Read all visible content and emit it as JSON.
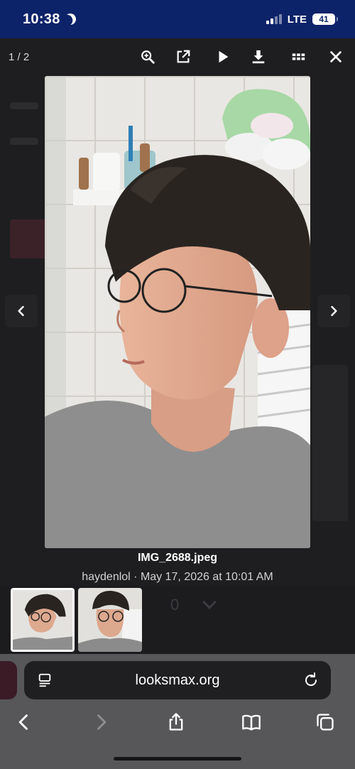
{
  "status": {
    "time": "10:38",
    "network": "LTE",
    "battery": "41"
  },
  "lightbox": {
    "counter": "1 / 2",
    "toolbar_icons": [
      "zoom-in-icon",
      "open-external-icon",
      "play-icon",
      "download-icon",
      "grid-icon",
      "close-icon"
    ],
    "caption": {
      "filename": "IMG_2688.jpeg",
      "meta": "haydenlol · May 17, 2026 at 10:01 AM"
    },
    "thumbnails": [
      {
        "label": "thumbnail-1",
        "selected": true
      },
      {
        "label": "thumbnail-2",
        "selected": false
      }
    ],
    "behind_text": "0"
  },
  "browser": {
    "url": "looksmax.org"
  },
  "colors": {
    "status_bar": "#0d2369",
    "toolbar_bg": "#575659",
    "address_bar": "#1f1f21"
  }
}
